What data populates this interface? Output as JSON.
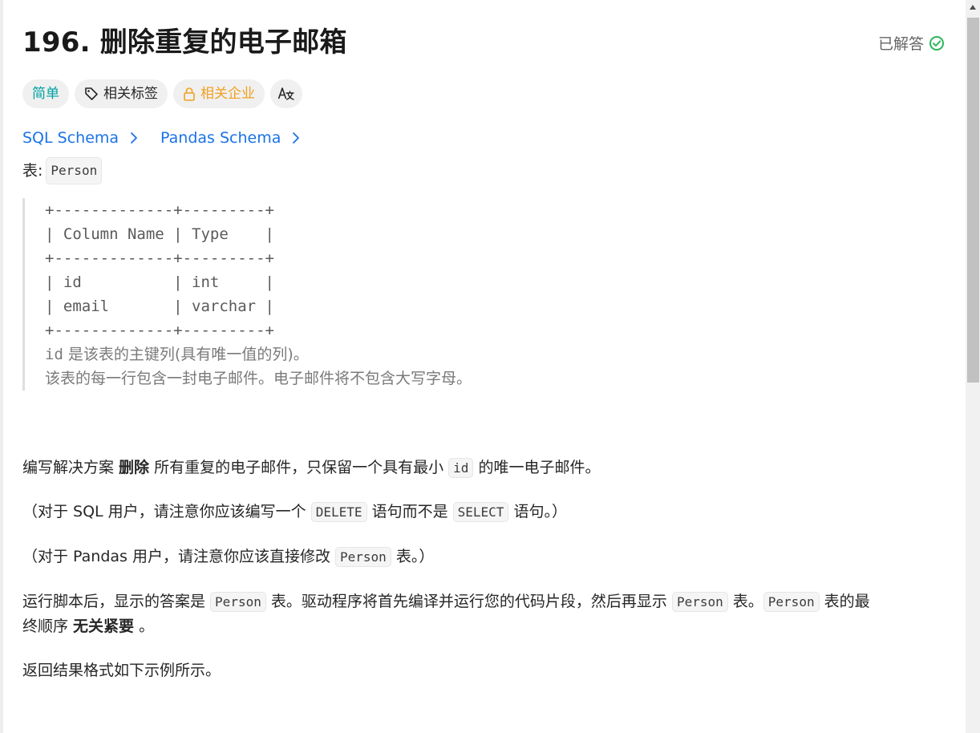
{
  "problem": {
    "title": "196. 删除重复的电子邮箱",
    "status_label": "已解答"
  },
  "tags": {
    "difficulty": "简单",
    "related_tags": "相关标签",
    "related_companies": "相关企业",
    "translate_glyph": "Aあ"
  },
  "schema_links": {
    "sql": "SQL Schema",
    "pandas": "Pandas Schema"
  },
  "description": {
    "table_label": "表: ",
    "table_name": "Person",
    "schema_block": "+-------------+---------+\n| Column Name | Type    |\n+-------------+---------+\n| id          | int     |\n| email       | varchar |\n+-------------+---------+",
    "note_1_code": "id",
    "note_1_text": " 是该表的主键列(具有唯一值的列)。",
    "note_2": "该表的每一行包含一封电子邮件。电子邮件将不包含大写字母。",
    "p1_a": "编写解决方案 ",
    "p1_bold": "删除",
    "p1_b": " 所有重复的电子邮件，只保留一个具有最小 ",
    "p1_code": "id",
    "p1_c": " 的唯一电子邮件。",
    "p2_a": "（对于 SQL 用户，请注意你应该编写一个 ",
    "p2_code1": "DELETE",
    "p2_b": " 语句而不是 ",
    "p2_code2": "SELECT",
    "p2_c": " 语句。）",
    "p3_a": "（对于 Pandas 用户，请注意你应该直接修改 ",
    "p3_code": "Person",
    "p3_b": " 表。）",
    "p4_a": "运行脚本后，显示的答案是 ",
    "p4_code1": "Person",
    "p4_b": " 表。驱动程序将首先编译并运行您的代码片段，然后再显示 ",
    "p4_code2": "Person",
    "p4_c": " 表。",
    "p4_code3": "Person",
    "p4_d": " 表的最",
    "p4_e": "终顺序 ",
    "p4_bold": "无关紧要",
    "p4_f": " 。",
    "p5": "返回结果格式如下示例所示。"
  },
  "colors": {
    "easy": "#00a2a2",
    "locked": "#f0a020",
    "link": "#1a73e8",
    "solved_check": "#2db55d"
  }
}
